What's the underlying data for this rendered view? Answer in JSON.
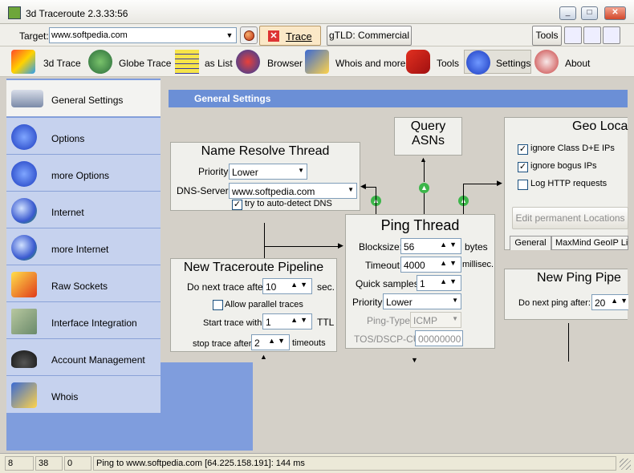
{
  "window": {
    "title": "3d Traceroute 2.3.33:56"
  },
  "target": {
    "label": "Target:",
    "value": "www.softpedia.com"
  },
  "buttons": {
    "trace": "Trace",
    "gtld": "gTLD: Commercial",
    "tools": "Tools"
  },
  "toolbar": [
    {
      "label": "3d Trace",
      "icon": "3d-chart-icon"
    },
    {
      "label": "Globe Trace",
      "icon": "globe-trace-icon"
    },
    {
      "label": "as List",
      "icon": "list-grid-icon"
    },
    {
      "label": "Browser",
      "icon": "browser-icon"
    },
    {
      "label": "Whois and more",
      "icon": "whois-icon"
    },
    {
      "label": "Tools",
      "icon": "wrench-icon"
    },
    {
      "label": "Settings",
      "icon": "gears-icon"
    },
    {
      "label": "About",
      "icon": "info-icon"
    }
  ],
  "sidebar": [
    {
      "label": "General Settings",
      "icon": "network-cable-icon"
    },
    {
      "label": "Options",
      "icon": "gear-icon"
    },
    {
      "label": "more Options",
      "icon": "gears-icon"
    },
    {
      "label": "Internet",
      "icon": "globe-icon"
    },
    {
      "label": "more Internet",
      "icon": "globes-icon"
    },
    {
      "label": "Raw Sockets",
      "icon": "lightning-icon"
    },
    {
      "label": "Interface Integration",
      "icon": "map-icon"
    },
    {
      "label": "Account Management",
      "icon": "hat-icon"
    },
    {
      "label": "Whois",
      "icon": "whois-icon"
    }
  ],
  "main": {
    "header": "General Settings",
    "query_asns": {
      "line1": "Query",
      "line2": "ASNs"
    },
    "name_resolve": {
      "title": "Name Resolve Thread",
      "priority_label": "Priority:",
      "priority_value": "Lower",
      "dns_label": "DNS-Server:",
      "dns_value": "www.softpedia.com",
      "autodetect_label": "try to auto-detect DNS",
      "autodetect_checked": "✓"
    },
    "ping": {
      "title": "Ping Thread",
      "blocksize_label": "Blocksize:",
      "blocksize_value": "56",
      "blocksize_unit": "bytes",
      "timeout_label": "Timeout:",
      "timeout_value": "4000",
      "timeout_unit": "millisec.",
      "quick_label": "Quick samples:",
      "quick_value": "1",
      "priority_label": "Priority:",
      "priority_value": "Lower",
      "pingtype_label": "Ping-Type:",
      "pingtype_value": "ICMP",
      "tos_label": "TOS/DSCP-CU:",
      "tos_value": "00000000"
    },
    "pipeline": {
      "title": "New Traceroute Pipeline",
      "donext_label": "Do next trace after:",
      "donext_value": "10",
      "donext_unit": "sec.",
      "parallel_label": "Allow parallel traces",
      "start_label": "Start trace with",
      "start_value": "1",
      "start_unit": "TTL",
      "stop_label": "stop trace after",
      "stop_value": "2",
      "stop_unit": "timeouts"
    },
    "geo": {
      "title": "Geo Loca",
      "opt1": "ignore Class D+E IPs",
      "opt1_checked": "✓",
      "opt2": "ignore bogus IPs",
      "opt2_checked": "✓",
      "opt3": "Log HTTP requests",
      "edit_btn": "Edit permanent Locations",
      "tab1": "General",
      "tab2": "MaxMind GeoIP Lit"
    },
    "newping": {
      "title": "New Ping Pipe",
      "label": "Do next ping after:",
      "value": "20"
    }
  },
  "status": {
    "c1": "8",
    "c2": "38",
    "c3": "0",
    "message": "Ping to www.softpedia.com [64.225.158.191]: 144 ms"
  }
}
